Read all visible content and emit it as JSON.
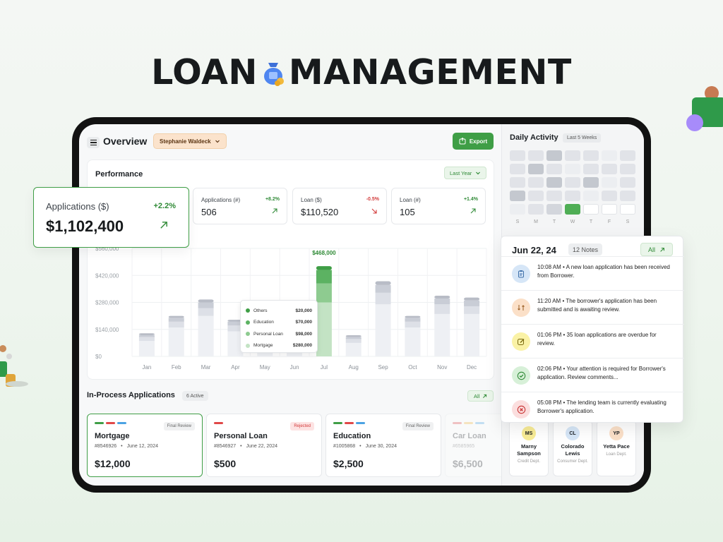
{
  "hero": {
    "title_left": "LOAN",
    "title_right": "MANAGEMENT"
  },
  "header": {
    "title": "Overview",
    "user": "Stephanie Waldeck",
    "export": "Export"
  },
  "performance": {
    "title": "Performance",
    "period": "Last Year",
    "highlight": {
      "label": "Applications ($)",
      "change": "+2.2%",
      "value": "$1,102,400"
    },
    "stats": [
      {
        "label": "Applications (#)",
        "change": "+8.2%",
        "value": "506",
        "trend": "up"
      },
      {
        "label": "Loan ($)",
        "change": "-0.5%",
        "value": "$110,520",
        "trend": "down"
      },
      {
        "label": "Loan (#)",
        "change": "+1.4%",
        "value": "105",
        "trend": "up"
      }
    ]
  },
  "chart_data": {
    "type": "bar",
    "categories": [
      "Jan",
      "Feb",
      "Mar",
      "Apr",
      "May",
      "Jun",
      "Jul",
      "Aug",
      "Sep",
      "Oct",
      "Nov",
      "Dec"
    ],
    "y_tick_labels": [
      "$560,000",
      "$420,000",
      "$280,000",
      "$140,000",
      "$0"
    ],
    "ylim": [
      0,
      560000
    ],
    "series": [
      {
        "name": "Mortgage",
        "values": [
          80000,
          150000,
          210000,
          130000,
          140000,
          150000,
          280000,
          70000,
          270000,
          150000,
          220000,
          220000
        ]
      },
      {
        "name": "Personal Loan",
        "values": [
          20000,
          30000,
          40000,
          30000,
          30000,
          40000,
          98000,
          20000,
          60000,
          30000,
          50000,
          40000
        ]
      },
      {
        "name": "Education",
        "values": [
          10000,
          20000,
          30000,
          20000,
          20000,
          30000,
          70000,
          10000,
          40000,
          20000,
          30000,
          30000
        ]
      },
      {
        "name": "Others",
        "values": [
          10000,
          10000,
          15000,
          10000,
          10000,
          10000,
          20000,
          10000,
          20000,
          10000,
          15000,
          15000
        ]
      }
    ],
    "highlight_label": "$468,000",
    "highlight_index": 6,
    "tooltip": [
      {
        "name": "Others",
        "value": "$20,000",
        "color": "#3f9e46"
      },
      {
        "name": "Education",
        "value": "$70,000",
        "color": "#5cb262"
      },
      {
        "name": "Personal Loan",
        "value": "$98,000",
        "color": "#8ecb90"
      },
      {
        "name": "Mortgage",
        "value": "$280,000",
        "color": "#c3e3c4"
      }
    ],
    "grid": true
  },
  "inprocess": {
    "title": "In-Process Applications",
    "count": "6 Active",
    "all": "All",
    "cards": [
      {
        "name": "Mortgage",
        "id": "#8546926",
        "date": "June 12, 2024",
        "amount": "$12,000",
        "status": "Final Review"
      },
      {
        "name": "Personal Loan",
        "id": "#8546927",
        "date": "June 22, 2024",
        "amount": "$500",
        "status": "Rejected"
      },
      {
        "name": "Education",
        "id": "#1005868",
        "date": "June 30, 2024",
        "amount": "$2,500",
        "status": "Final Review"
      },
      {
        "name": "Car Loan",
        "id": "#6585965",
        "date": "",
        "amount": "$6,500",
        "status": ""
      }
    ]
  },
  "activity": {
    "title": "Daily Activity",
    "range": "Last 5 Weeks",
    "days": [
      "S",
      "M",
      "T",
      "W",
      "T",
      "F",
      "S"
    ],
    "notes_panel": {
      "date": "Jun 22, 24",
      "notes": "12 Notes",
      "all": "All",
      "items": [
        {
          "time": "10:08 AM",
          "text": "A new loan application has been received from Borrower.",
          "icon": "clipboard-icon",
          "color": "#d6e6f7"
        },
        {
          "time": "11:20 AM",
          "text": "The borrower's application has been submitted and is awaiting review.",
          "icon": "transfer-icon",
          "color": "#fbe0c8"
        },
        {
          "time": "01:06 PM",
          "text": "35 loan applications are overdue for review.",
          "icon": "edit-icon",
          "color": "#faf2a6"
        },
        {
          "time": "02:06 PM",
          "text": "Your attention is required for Borrower's application. Review comments...",
          "icon": "check-circle-icon",
          "color": "#d7f0d8"
        },
        {
          "time": "05:08 PM",
          "text": "The lending team is currently evaluating Borrower's application.",
          "icon": "x-circle-icon",
          "color": "#fbdede"
        }
      ]
    },
    "people": [
      {
        "initials": "MS",
        "name": "Marny Sampson",
        "dept": "Credit Dept.",
        "color": "#f8ec96"
      },
      {
        "initials": "CL",
        "name": "Colorado Lewis",
        "dept": "Consumer Dept.",
        "color": "#d6e6f7"
      },
      {
        "initials": "YP",
        "name": "Yetta Pace",
        "dept": "Loan Dept.",
        "color": "#fbe0c8"
      }
    ]
  }
}
